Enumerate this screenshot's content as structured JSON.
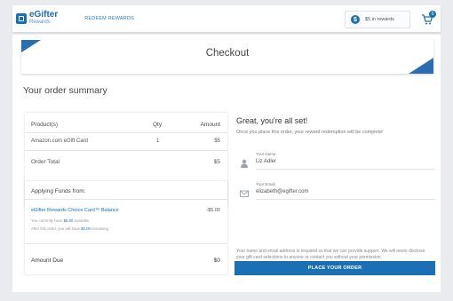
{
  "header": {
    "logo_main": "eGifter",
    "logo_sub": "Rewards",
    "nav_redeem": "REDEEM REWARDS",
    "rewards_balance": "$5 in rewards",
    "cart_count": "0"
  },
  "checkout": {
    "banner_title": "Checkout",
    "summary_title": "Your order summary"
  },
  "order_table": {
    "columns": [
      "Product(s)",
      "Qty",
      "Amount"
    ],
    "rows": [
      {
        "product": "Amazon.com eGift Card",
        "qty": "1",
        "amount": "$5"
      }
    ],
    "total_label": "Order Total",
    "total_amount": "$5"
  },
  "funds": {
    "title": "Applying Funds from:",
    "source_name": "eGifter Rewards Choice Card™ Balance",
    "source_amount": "-$5.00",
    "note1_prefix": "You currently have ",
    "note1_amount": "$5.00",
    "note1_suffix": " available",
    "note2_prefix": "After this order, you will have ",
    "note2_amount": "$0.00",
    "note2_suffix": " remaining",
    "amount_due_label": "Amount Due",
    "amount_due_value": "$0"
  },
  "confirmation": {
    "heading": "Great, you're all set!",
    "subtext": "Once you place this order, your reward redemption will be complete!",
    "name_label": "Your Name",
    "name_value": "Liz Adler",
    "email_label": "Your Email",
    "email_value": "elizabeth@egifter.com",
    "notice": "Your name and email address is required so that we can provide support. We will never disclose your gift card selections to anyone or contact you without your permission.",
    "place_order_label": "PLACE YOUR ORDER"
  },
  "colors": {
    "brand_blue": "#1a6fb5",
    "banner_blue": "#2a6db0"
  }
}
